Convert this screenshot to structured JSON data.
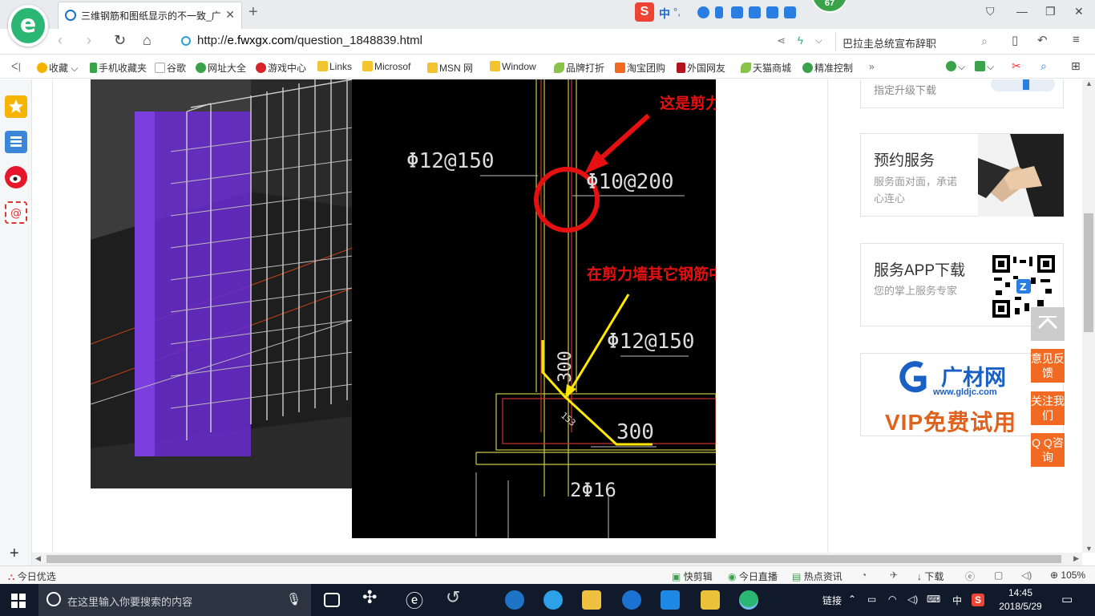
{
  "browser": {
    "tab_title": "三维钢筋和图纸显示的不一致_广",
    "tab_close": "✕",
    "new_tab": "+",
    "notification_badge": "67",
    "ime_label": "中",
    "tray_extra": "°,"
  },
  "address": {
    "url_prefix": "http://",
    "url_host": "e.fwxgx.com",
    "url_path": "/question_1848839.html",
    "search_query": "巴拉圭总统宣布辞职"
  },
  "bookmarks": [
    {
      "label": "收藏",
      "icon": "star-icon"
    },
    {
      "label": "手机收藏夹",
      "icon": "phone-icon"
    },
    {
      "label": "谷歌",
      "icon": "page-icon"
    },
    {
      "label": "网址大全",
      "icon": "globe-icon"
    },
    {
      "label": "游戏中心",
      "icon": "game-icon"
    },
    {
      "label": "Links",
      "icon": "folder-icon"
    },
    {
      "label": "Microsof",
      "icon": "folder-icon"
    },
    {
      "label": "MSN 网",
      "icon": "folder-icon"
    },
    {
      "label": "Window",
      "icon": "folder-icon"
    },
    {
      "label": "品牌打折",
      "icon": "leaf-icon"
    },
    {
      "label": "淘宝团购",
      "icon": "taobao-icon"
    },
    {
      "label": "外国网友",
      "icon": "flag-icon"
    },
    {
      "label": "天猫商城",
      "icon": "leaf-icon"
    },
    {
      "label": "精准控制",
      "icon": "wechat-icon"
    }
  ],
  "cad": {
    "label_wall_horizontal": "这是剪力墙水平钢筋",
    "label_other_rebar": "在剪力墙其它钢筋中输入",
    "dim_phi12_150_top": "Φ12@150",
    "dim_phi10_200": "Φ10@200",
    "dim_phi12_150_mid": "Φ12@150",
    "dim_300_vertical": "300",
    "dim_300_horizontal": "300",
    "dim_153": "153",
    "dim_2phi16": "2Φ16"
  },
  "right_cards": {
    "upgrade_text": "指定升级下载",
    "booking_title": "预约服务",
    "booking_desc": "服务面对面，承诺心连心",
    "app_title": "服务APP下载",
    "app_desc": "您的掌上服务专家",
    "ad_brand": "广材网",
    "ad_url": "www.gldjc.com",
    "ad_slogan": "VIP免费试用"
  },
  "float_buttons": {
    "feedback": "意见反馈",
    "follow": "关注我们",
    "qq": "Q Q咨询"
  },
  "statusbar": {
    "left": "今日优选",
    "quick_clip": "快剪辑",
    "live": "今日直播",
    "news": "热点资讯",
    "download": "下载",
    "zoom": "105%"
  },
  "taskbar": {
    "search_placeholder": "在这里输入你要搜索的内容",
    "tray_link": "链接",
    "ime": "中",
    "time": "14:45",
    "date": "2018/5/29"
  }
}
